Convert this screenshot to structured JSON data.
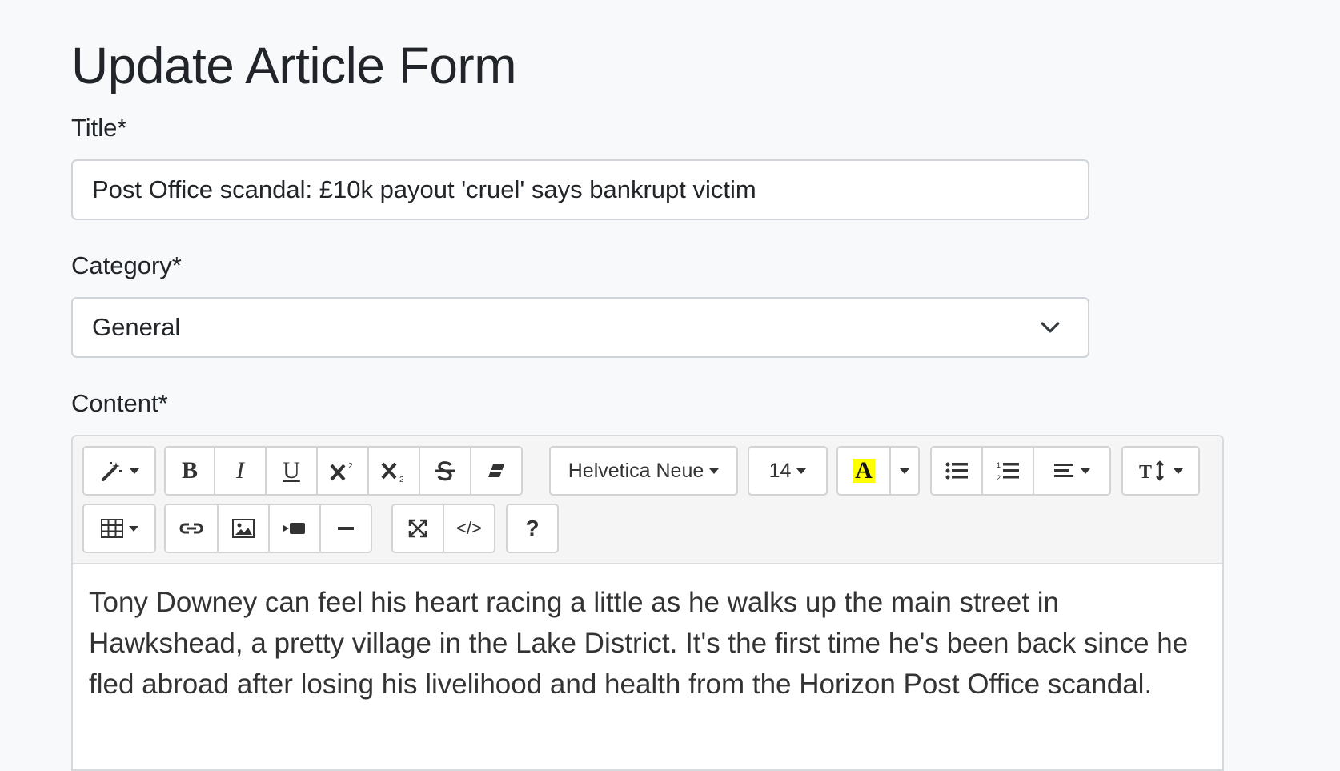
{
  "page": {
    "title": "Update Article Form"
  },
  "form": {
    "title_label": "Title*",
    "title_value": "Post Office scandal: £10k payout 'cruel' says bankrupt victim",
    "category_label": "Category*",
    "category_value": "General",
    "content_label": "Content*"
  },
  "toolbar": {
    "font_family": "Helvetica Neue",
    "font_size": "14",
    "bold": "B",
    "italic": "I",
    "underline": "U",
    "highlight_letter": "A",
    "help": "?",
    "code_view": "</>",
    "highlight_color": "#ffff00"
  },
  "editor": {
    "content": "Tony Downey can feel his heart racing a little as he walks up the main street in Hawkshead, a pretty village in the Lake District. It's the first time he's been back since he fled abroad after losing his livelihood and health from the Horizon Post Office scandal."
  }
}
